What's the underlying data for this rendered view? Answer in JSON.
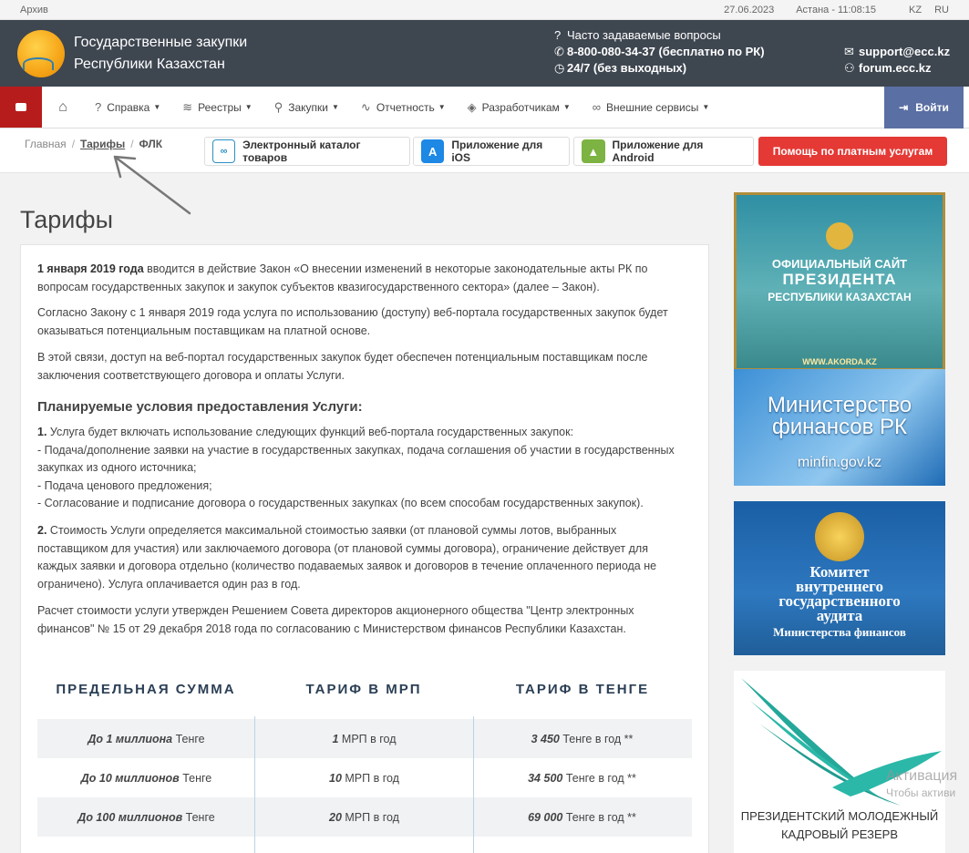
{
  "topbar": {
    "archive": "Архив",
    "date": "27.06.2023",
    "time": "Астана - 11:08:15",
    "lang_kz": "KZ",
    "lang_ru": "RU"
  },
  "header": {
    "title_line1": "Государственные закупки",
    "title_line2": "Республики Казахстан",
    "faq": "Часто задаваемые вопросы",
    "phone": "8-800-080-34-37 (бесплатно по РК)",
    "hours": "24/7 (без выходных)",
    "email": "support@ecc.kz",
    "forum": "forum.ecc.kz"
  },
  "nav": {
    "items": [
      {
        "label": "Справка",
        "icon": "question-icon"
      },
      {
        "label": "Реестры",
        "icon": "layers-icon"
      },
      {
        "label": "Закупки",
        "icon": "search-icon"
      },
      {
        "label": "Отчетность",
        "icon": "chart-line-icon"
      },
      {
        "label": "Разработчикам",
        "icon": "tag-icon"
      },
      {
        "label": "Внешние сервисы",
        "icon": "link-icon"
      }
    ],
    "login": "Войти"
  },
  "breadcrumb": {
    "home": "Главная",
    "current": "Тарифы",
    "last": "ФЛК"
  },
  "subbar": {
    "catalog": "Электронный каталог товаров",
    "ios": "Приложение для iOS",
    "android": "Приложение для Android",
    "help": "Помощь по платным услугам"
  },
  "main": {
    "title": "Тарифы",
    "p1_bold": "1 января 2019 года",
    "p1_line1": " вводится в действие Закон «О внесении изменений в некоторые законодательные акты РК по",
    "p1_line2": "вопросам государственных закупок и закупок субъектов квазигосударственного сектора» (далее – Закон).",
    "p2_line1": "Согласно Закону с 1 января 2019 года услуга по использованию (доступу) веб-портала государственных закупок будет",
    "p2_line2": "оказываться потенциальным поставщикам на платной основе.",
    "p3_line1": "В этой связи, доступ на веб-портал государственных закупок будет обеспечен потенциальным поставщикам после",
    "p3_line2": "заключения соответствующего договора и оплаты Услуги.",
    "subhead": "Планируемые условия предоставления Услуги:",
    "l1_num": "1.",
    "l1": " Услуга будет включать использование следующих функций веб-портала государственных закупок:",
    "l2": "- Подача/дополнение заявки на участие в государственных закупках, подача соглашения об участии в государственных",
    "l3": "закупках из одного источника;",
    "l4": "- Подача ценового предложения;",
    "l5": "- Согласование и подписание договора о государственных закупках (по всем способам государственных закупок).",
    "m1_num": "2.",
    "m1": " Стоимость Услуги определяется максимальной стоимостью заявки (от плановой суммы лотов, выбранных",
    "m2": "поставщиком для участия) или заключаемого договора (от плановой суммы договора), ограничение действует для",
    "m3": "каждых заявки и договора отдельно (количество подаваемых заявок и договоров в течение оплаченного периода не",
    "m4": "ограничено). Услуга оплачивается один раз в год.",
    "r1": "Расчет стоимости услуги утвержден Решением Совета директоров акционерного общества \"Центр электронных",
    "r2": "финансов\" № 15 от 29 декабря 2018 года по согласованию с Министерством финансов Республики Казахстан."
  },
  "tariffs": {
    "headers": [
      "ПРЕДЕЛЬНАЯ СУММА",
      "ТАРИФ В МРП",
      "ТАРИФ В ТЕНГЕ"
    ],
    "rows": [
      {
        "limit_b": "До 1 миллиона",
        "limit_s": " Тенге",
        "mrp_b": "1",
        "mrp_s": " МРП в год",
        "kzt_b": "3 450",
        "kzt_s": " Тенге в год **"
      },
      {
        "limit_b": "До 10 миллионов",
        "limit_s": " Тенге",
        "mrp_b": "10",
        "mrp_s": " МРП в год",
        "kzt_b": "34 500",
        "kzt_s": " Тенге в год **"
      },
      {
        "limit_b": "До 100 миллионов",
        "limit_s": " Тенге",
        "mrp_b": "20",
        "mrp_s": " МРП в год",
        "kzt_b": "69 000",
        "kzt_s": " Тенге в год **"
      }
    ]
  },
  "sidebar": {
    "akorda_l1": "ОФИЦИАЛЬНЫЙ САЙТ",
    "akorda_l2": "ПРЕЗИДЕНТА",
    "akorda_l3": "РЕСПУБЛИКИ КАЗАХСТАН",
    "akorda_url": "WWW.AKORDA.KZ",
    "minfin_l1": "Министерство финансов РК",
    "minfin_url": "minfin.gov.kz",
    "audit_t1": "Комитет",
    "audit_t2": "внутреннего",
    "audit_t3": "государственного",
    "audit_t4": "аудита",
    "audit_sub": "Министерства финансов",
    "reserve_l1": "ПРЕЗИДЕНТСКИЙ МОЛОДЕЖНЫЙ",
    "reserve_l2": "КАДРОВЫЙ РЕЗЕРВ"
  },
  "watermark": {
    "line1": "Активация",
    "line2": "Чтобы активи"
  },
  "colors": {
    "header_bg": "#3e4650",
    "login_bg": "#5a6fa3",
    "help_btn": "#e53935",
    "youtube": "#b71c1c",
    "tariff_head": "#2b3f55"
  }
}
